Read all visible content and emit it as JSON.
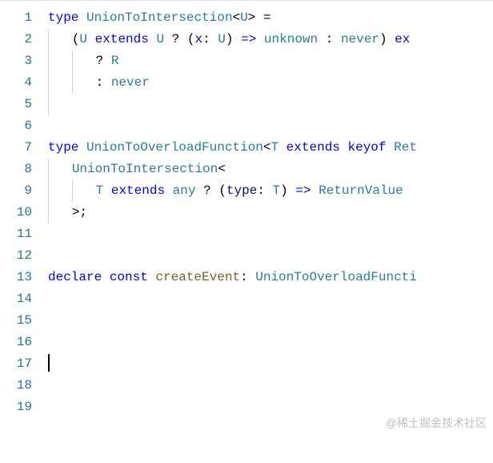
{
  "editor": {
    "lineCount": 19,
    "lines": {
      "1": [
        {
          "t": "type ",
          "c": "kw"
        },
        {
          "t": "UnionToIntersection",
          "c": "type"
        },
        {
          "t": "<",
          "c": "punct"
        },
        {
          "t": "U",
          "c": "type"
        },
        {
          "t": "> =",
          "c": "punct"
        }
      ],
      "2": [
        {
          "t": "    (",
          "c": "punct"
        },
        {
          "t": "U",
          "c": "type"
        },
        {
          "t": " extends ",
          "c": "kw"
        },
        {
          "t": "U",
          "c": "type"
        },
        {
          "t": " ? (",
          "c": "punct"
        },
        {
          "t": "x",
          "c": "var"
        },
        {
          "t": ": ",
          "c": "punct"
        },
        {
          "t": "U",
          "c": "type"
        },
        {
          "t": ") ",
          "c": "punct"
        },
        {
          "t": "=>",
          "c": "kw"
        },
        {
          "t": " ",
          "c": "punct"
        },
        {
          "t": "unknown",
          "c": "type"
        },
        {
          "t": " : ",
          "c": "punct"
        },
        {
          "t": "never",
          "c": "type"
        },
        {
          "t": ") ",
          "c": "punct"
        },
        {
          "t": "ex",
          "c": "kw"
        }
      ],
      "3": [
        {
          "t": "        ? ",
          "c": "punct"
        },
        {
          "t": "R",
          "c": "type"
        }
      ],
      "4": [
        {
          "t": "        : ",
          "c": "punct"
        },
        {
          "t": "never",
          "c": "type"
        }
      ],
      "5": [],
      "6": [],
      "7": [
        {
          "t": "type ",
          "c": "kw"
        },
        {
          "t": "UnionToOverloadFunction",
          "c": "type"
        },
        {
          "t": "<",
          "c": "punct"
        },
        {
          "t": "T",
          "c": "type"
        },
        {
          "t": " extends ",
          "c": "kw"
        },
        {
          "t": "keyof ",
          "c": "kw"
        },
        {
          "t": "Ret",
          "c": "type"
        }
      ],
      "8": [
        {
          "t": "    ",
          "c": "punct"
        },
        {
          "t": "UnionToIntersection",
          "c": "type"
        },
        {
          "t": "<",
          "c": "punct"
        }
      ],
      "9": [
        {
          "t": "        ",
          "c": "punct"
        },
        {
          "t": "T",
          "c": "type"
        },
        {
          "t": " extends ",
          "c": "kw"
        },
        {
          "t": "any",
          "c": "type"
        },
        {
          "t": " ? (",
          "c": "punct"
        },
        {
          "t": "type",
          "c": "var"
        },
        {
          "t": ": ",
          "c": "punct"
        },
        {
          "t": "T",
          "c": "type"
        },
        {
          "t": ") ",
          "c": "punct"
        },
        {
          "t": "=>",
          "c": "kw"
        },
        {
          "t": " ",
          "c": "punct"
        },
        {
          "t": "ReturnValue",
          "c": "type"
        }
      ],
      "10": [
        {
          "t": "    >;",
          "c": "punct"
        }
      ],
      "11": [],
      "12": [],
      "13": [
        {
          "t": "declare ",
          "c": "kw"
        },
        {
          "t": "const ",
          "c": "kw"
        },
        {
          "t": "createEvent",
          "c": "fn"
        },
        {
          "t": ": ",
          "c": "punct"
        },
        {
          "t": "UnionToOverloadFuncti",
          "c": "type"
        }
      ],
      "14": [],
      "15": [],
      "16": [],
      "17": [],
      "18": [],
      "19": []
    },
    "cursorLine": 17,
    "indentGuides": {
      "2": [
        0
      ],
      "3": [
        0,
        4
      ],
      "4": [
        0,
        4
      ],
      "5": [
        0
      ],
      "8": [
        0
      ],
      "9": [
        0,
        4
      ],
      "10": [
        0
      ]
    }
  },
  "watermark": "@稀土掘金技术社区"
}
